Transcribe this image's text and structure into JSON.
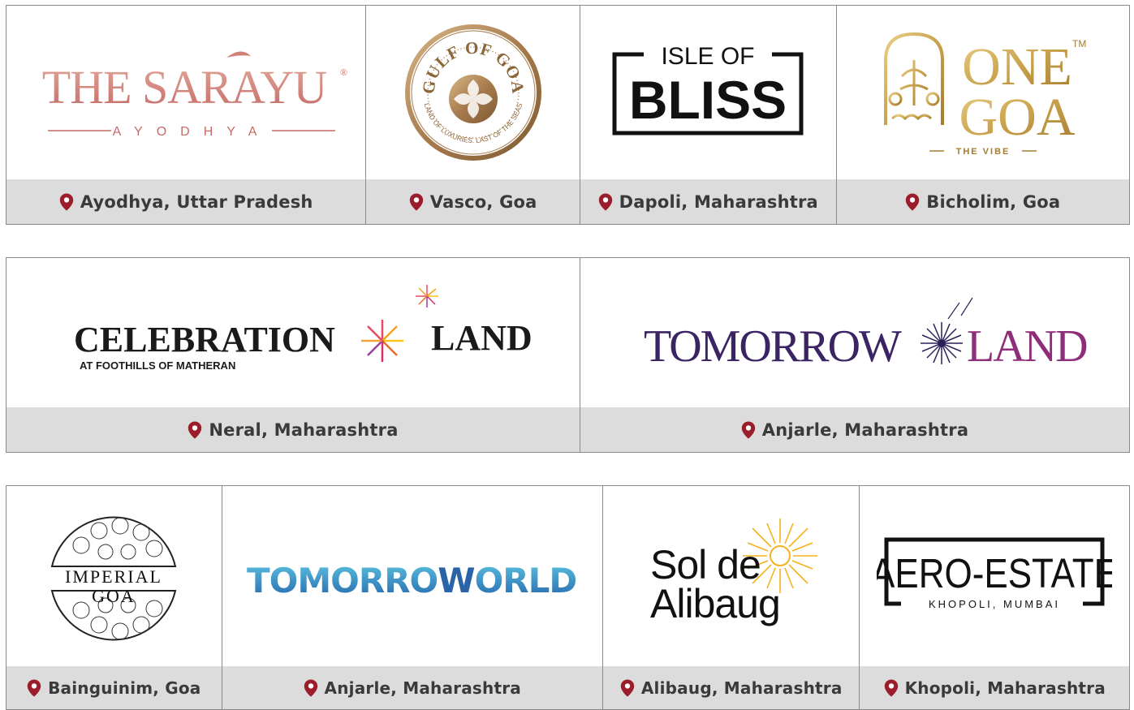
{
  "colors": {
    "pin": "#9b1c2a",
    "location_bar": "#dcdcdd",
    "location_text": "#3a3a3a",
    "border": "#8a8a8a"
  },
  "rows": [
    {
      "cells": [
        {
          "logo": {
            "name": "THE SARAYU",
            "trademark": "®",
            "tagline": "AYODHYA"
          },
          "location": "Ayodhya, Uttar Pradesh"
        },
        {
          "logo": {
            "name": "GULF OF GOA",
            "tagline": "LAND OF LUXURIES. LAST OF THE SEAS"
          },
          "location": "Vasco, Goa"
        },
        {
          "logo": {
            "line1": "ISLE OF",
            "line2": "BLISS"
          },
          "location": "Dapoli, Maharashtra"
        },
        {
          "logo": {
            "line1": "ONE",
            "line2": "GOA",
            "trademark": "TM",
            "tagline": "THE VIBE"
          },
          "location": "Bicholim, Goa"
        }
      ]
    },
    {
      "cells": [
        {
          "logo": {
            "word1": "CELEBRATION",
            "word2": "LAND",
            "tagline": "AT FOOTHILLS OF MATHERAN"
          },
          "location": "Neral, Maharashtra"
        },
        {
          "logo": {
            "word1": "TOMORROW",
            "word2": "LAND"
          },
          "location": "Anjarle, Maharashtra"
        }
      ]
    },
    {
      "cells": [
        {
          "logo": {
            "line1": "IMPERIAL",
            "line2": "GOA"
          },
          "location": "Bainguinim, Goa"
        },
        {
          "logo": {
            "word1": "TOMORRO",
            "letter": "W",
            "word2": "ORLD"
          },
          "location": "Anjarle, Maharashtra"
        },
        {
          "logo": {
            "line1": "Sol de",
            "line2": "Alibaug"
          },
          "location": "Alibaug, Maharashtra"
        },
        {
          "logo": {
            "name": "AERO-ESTATE",
            "tagline": "KHOPOLI, MUMBAI"
          },
          "location": "Khopoli, Maharashtra"
        }
      ]
    }
  ]
}
